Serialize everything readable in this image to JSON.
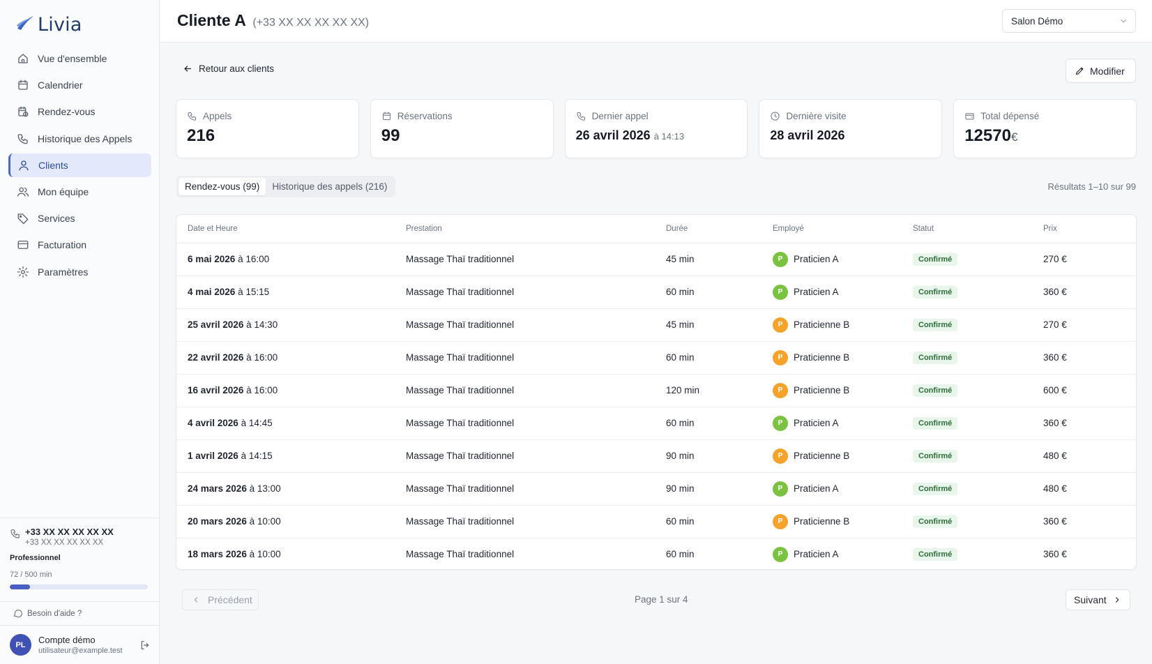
{
  "app": {
    "name": "Livia"
  },
  "sidebar": {
    "items": [
      {
        "label": "Vue d'ensemble",
        "icon": "home-icon"
      },
      {
        "label": "Calendrier",
        "icon": "calendar-icon"
      },
      {
        "label": "Rendez-vous",
        "icon": "calendar-clock-icon"
      },
      {
        "label": "Historique des Appels",
        "icon": "phone-icon"
      },
      {
        "label": "Clients",
        "icon": "user-icon",
        "active": true
      },
      {
        "label": "Mon équipe",
        "icon": "users-icon"
      },
      {
        "label": "Services",
        "icon": "tag-icon"
      },
      {
        "label": "Facturation",
        "icon": "credit-card-icon"
      },
      {
        "label": "Paramètres",
        "icon": "gear-icon"
      }
    ],
    "phone": {
      "main": "+33 XX XX XX XX XX",
      "sub": "+33 XX XX XX XX XX"
    },
    "plan": "Professionnel",
    "usage": {
      "label": "72 / 500 min",
      "fraction": 0.144
    },
    "help": "Besoin d'aide ?",
    "account": {
      "initials": "PL",
      "name": "Compte démo",
      "email": "utilisateur@example.test"
    }
  },
  "header": {
    "title": "Cliente A",
    "phone": "(+33 XX XX XX XX XX)",
    "salon": "Salon Démo"
  },
  "main": {
    "back_label": "Retour aux clients",
    "modify_label": "Modifier",
    "stats": [
      {
        "label": "Appels",
        "value": "216",
        "icon": "phone-icon"
      },
      {
        "label": "Réservations",
        "value": "99",
        "icon": "calendar-icon"
      },
      {
        "label": "Dernier appel",
        "value": "26 avril 2026",
        "sub": "à 14:13",
        "icon": "phone-icon"
      },
      {
        "label": "Dernière visite",
        "value": "28 avril 2026",
        "icon": "clock-icon"
      },
      {
        "label": "Total dépensé",
        "value": "12570",
        "unit": "€",
        "icon": "wallet-icon"
      }
    ],
    "tabs": [
      {
        "label": "Rendez-vous (99)",
        "active": true
      },
      {
        "label": "Historique des appels (216)",
        "active": false
      }
    ],
    "results": "Résultats 1–10 sur 99",
    "table": {
      "headers": [
        "Date et Heure",
        "Prestation",
        "Durée",
        "Employé",
        "Statut",
        "Prix"
      ],
      "rows": [
        {
          "date": "6 mai 2026",
          "time": "à 16:00",
          "service": "Massage Thaï traditionnel",
          "duration": "45 min",
          "employee": "Praticien A",
          "initial": "P",
          "color": "#7cc242",
          "status": "Confirmé",
          "price": "270 €"
        },
        {
          "date": "4 mai 2026",
          "time": "à 15:15",
          "service": "Massage Thaï traditionnel",
          "duration": "60 min",
          "employee": "Praticien A",
          "initial": "P",
          "color": "#7cc242",
          "status": "Confirmé",
          "price": "360 €"
        },
        {
          "date": "25 avril 2026",
          "time": "à 14:30",
          "service": "Massage Thaï traditionnel",
          "duration": "45 min",
          "employee": "Praticienne B",
          "initial": "P",
          "color": "#f5a32b",
          "status": "Confirmé",
          "price": "270 €"
        },
        {
          "date": "22 avril 2026",
          "time": "à 16:00",
          "service": "Massage Thaï traditionnel",
          "duration": "60 min",
          "employee": "Praticienne B",
          "initial": "P",
          "color": "#f5a32b",
          "status": "Confirmé",
          "price": "360 €"
        },
        {
          "date": "16 avril 2026",
          "time": "à 16:00",
          "service": "Massage Thaï traditionnel",
          "duration": "120 min",
          "employee": "Praticienne B",
          "initial": "P",
          "color": "#f5a32b",
          "status": "Confirmé",
          "price": "600 €"
        },
        {
          "date": "4 avril 2026",
          "time": "à 14:45",
          "service": "Massage Thaï traditionnel",
          "duration": "60 min",
          "employee": "Praticien A",
          "initial": "P",
          "color": "#7cc242",
          "status": "Confirmé",
          "price": "360 €"
        },
        {
          "date": "1 avril 2026",
          "time": "à 14:15",
          "service": "Massage Thaï traditionnel",
          "duration": "90 min",
          "employee": "Praticienne B",
          "initial": "P",
          "color": "#f5a32b",
          "status": "Confirmé",
          "price": "480 €"
        },
        {
          "date": "24 mars 2026",
          "time": "à 13:00",
          "service": "Massage Thaï traditionnel",
          "duration": "90 min",
          "employee": "Praticien A",
          "initial": "P",
          "color": "#7cc242",
          "status": "Confirmé",
          "price": "480 €"
        },
        {
          "date": "20 mars 2026",
          "time": "à 10:00",
          "service": "Massage Thaï traditionnel",
          "duration": "60 min",
          "employee": "Praticienne B",
          "initial": "P",
          "color": "#f5a32b",
          "status": "Confirmé",
          "price": "360 €"
        },
        {
          "date": "18 mars 2026",
          "time": "à 10:00",
          "service": "Massage Thaï traditionnel",
          "duration": "60 min",
          "employee": "Praticien A",
          "initial": "P",
          "color": "#7cc242",
          "status": "Confirmé",
          "price": "360 €"
        }
      ]
    },
    "pagination": {
      "prev": "Précédent",
      "info": "Page 1 sur 4",
      "next": "Suivant"
    }
  }
}
